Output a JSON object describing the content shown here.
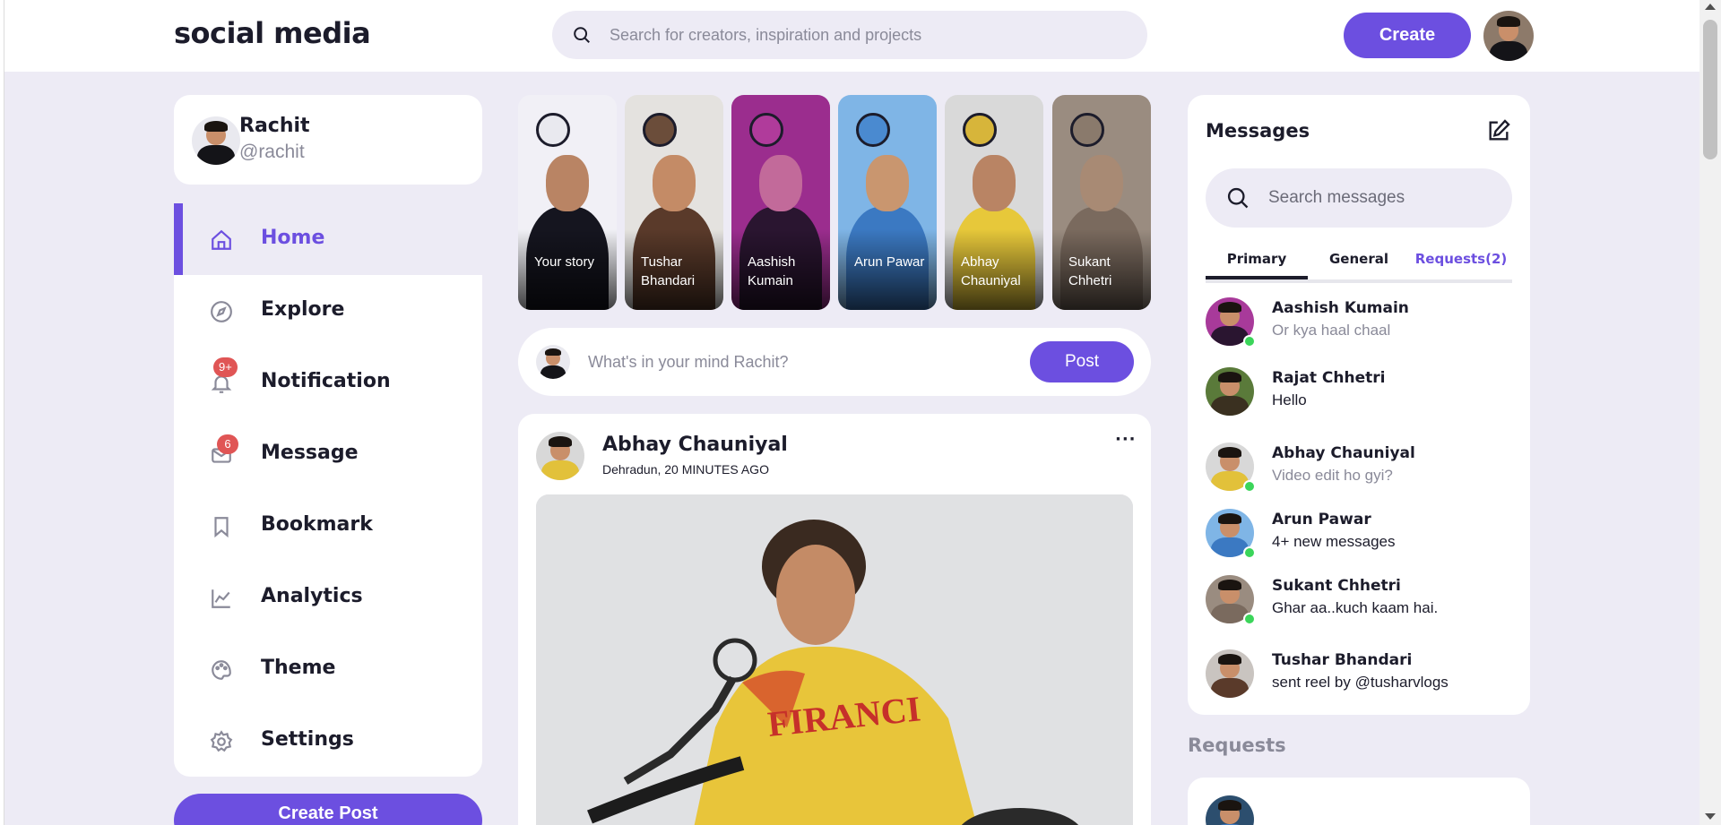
{
  "app": {
    "logo": "social media"
  },
  "search": {
    "placeholder": "Search for creators, inspiration and projects"
  },
  "header": {
    "create_label": "Create"
  },
  "profile": {
    "name": "Rachit",
    "handle": "@rachit"
  },
  "sidebar": {
    "items": [
      {
        "label": "Home",
        "icon": "home-icon",
        "active": true
      },
      {
        "label": "Explore",
        "icon": "compass-icon"
      },
      {
        "label": "Notification",
        "icon": "bell-icon",
        "badge": "9+"
      },
      {
        "label": "Message",
        "icon": "mail-icon",
        "badge": "6"
      },
      {
        "label": "Bookmark",
        "icon": "bookmark-icon"
      },
      {
        "label": "Analytics",
        "icon": "chart-icon"
      },
      {
        "label": "Theme",
        "icon": "palette-icon"
      },
      {
        "label": "Settings",
        "icon": "gear-icon"
      }
    ],
    "create_post_label": "Create Post"
  },
  "stories": [
    {
      "name": "Your story"
    },
    {
      "name": "Tushar Bhandari"
    },
    {
      "name": "Aashish Kumain"
    },
    {
      "name": "Arun Pawar"
    },
    {
      "name": "Abhay Chauniyal"
    },
    {
      "name": "Sukant Chhetri"
    }
  ],
  "composer": {
    "placeholder": "What's in your mind Rachit?",
    "post_label": "Post"
  },
  "feed": [
    {
      "author": "Abhay Chauniyal",
      "meta": "Dehradun, 20 MINUTES AGO",
      "more": "···"
    }
  ],
  "messages": {
    "title": "Messages",
    "search_placeholder": "Search messages",
    "tabs": [
      "Primary",
      "General",
      "Requests(2)"
    ],
    "items": [
      {
        "name": "Aashish Kumain",
        "text": "Or kya haal chaal",
        "online": true,
        "read": true
      },
      {
        "name": "Rajat Chhetri",
        "text": "Hello",
        "online": false,
        "read": false
      },
      {
        "name": "Abhay Chauniyal",
        "text": "Video edit ho gyi?",
        "online": true,
        "read": true
      },
      {
        "name": "Arun Pawar",
        "text": "4+ new messages",
        "online": true,
        "read": false
      },
      {
        "name": "Sukant Chhetri",
        "text": "Ghar aa..kuch kaam hai.",
        "online": true,
        "read": false
      },
      {
        "name": "Tushar Bhandari",
        "text": "sent reel by @tusharvlogs",
        "online": false,
        "read": false
      }
    ]
  },
  "requests": {
    "title": "Requests"
  },
  "colors": {
    "accent": "#6c4fe0",
    "background": "#edebf5",
    "badge": "#e05555",
    "online": "#3bd55a"
  }
}
